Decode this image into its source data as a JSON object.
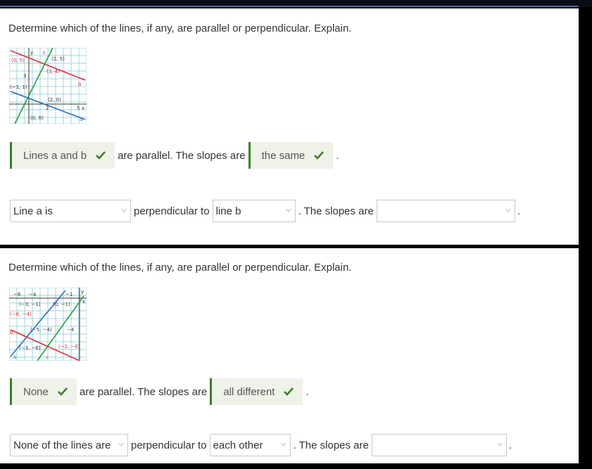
{
  "problems": [
    {
      "prompt": "Determine which of the lines, if any, are parallel or perpendicular. Explain.",
      "graph_labels": [
        "y",
        "c",
        "(0, 5)",
        "(2, 5)",
        "(3, 4)",
        "b",
        "3",
        "(−1, 1)",
        "(2, 0)",
        "2",
        "5",
        "x",
        "(0, 0)",
        "a"
      ],
      "answer1": "Lines a and b",
      "text1": "are parallel. The slopes are",
      "answer2": "the same",
      "dot1": ".",
      "dropdown1": "Line a is",
      "text2": "perpendicular to",
      "dropdown2": "line b",
      "text3": ". The slopes are",
      "dropdown3": "",
      "dot2": "."
    },
    {
      "prompt": "Determine which of the lines, if any, are parallel or perpendicular. Explain.",
      "graph_labels": [
        "−6",
        "−4",
        "−1",
        "y",
        "x",
        "(−3, −1)",
        "(0, −1)",
        "(−6, −4)",
        "(−5, −4)",
        "−4",
        "b",
        "(−3, −6)",
        "(−2, −6)",
        "a",
        "c"
      ],
      "answer1": "None",
      "text1": "are parallel. The slopes are",
      "answer2": "all different",
      "dot1": ".",
      "dropdown1": "None of the lines are",
      "text2": "perpendicular to",
      "dropdown2": "each other",
      "text3": ". The slopes are",
      "dropdown3": "",
      "dot2": "."
    }
  ],
  "colors": {
    "line_red": "#d9303e",
    "line_green": "#2e9a4a",
    "line_blue": "#2a6fb3",
    "grid": "#9fd4e0",
    "check": "#3e7d2a"
  }
}
